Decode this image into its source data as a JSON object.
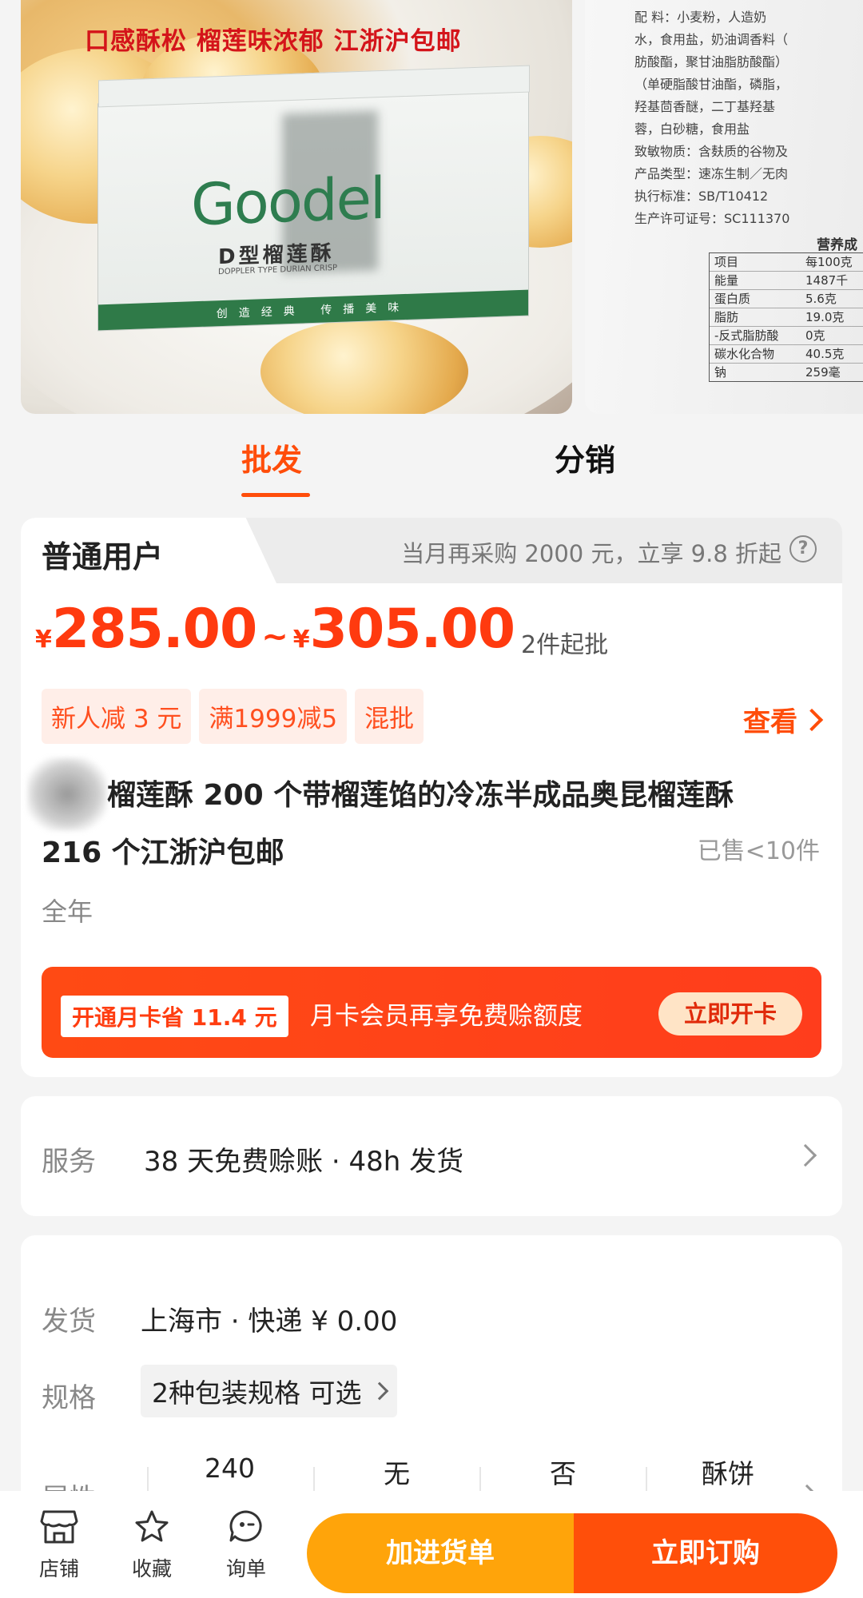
{
  "gallery": {
    "banner_text": "口感酥松 榴莲味浓郁 江浙沪包邮",
    "box_brand": "Goodel",
    "box_subtitle": "D型榴莲酥",
    "box_subtitle_en": "DOPPLER TYPE DURIAN CRISP",
    "box_slogan": "创造经典 传播美味",
    "label_lines": [
      "配    料：小麦粉，人造奶",
      "水，食用盐，奶油调香料（",
      "肪酸酯，聚甘油脂肪酸酯）",
      "（单硬脂酸甘油酯，磷脂，",
      "羟基茴香醚，二丁基羟基",
      "蓉，白砂糖，食用盐",
      "致敏物质：含麸质的谷物及",
      "产品类型：速冻生制／无肉",
      "执行标准：SB/T10412",
      "生产许可证号：SC111370"
    ],
    "nutrition_title": "营养成",
    "nutrition_rows": [
      {
        "item": "项目",
        "value": "每100克"
      },
      {
        "item": "能量",
        "value": "1487千"
      },
      {
        "item": "蛋白质",
        "value": "5.6克"
      },
      {
        "item": "脂肪",
        "value": "19.0克"
      },
      {
        "item": "-反式脂肪酸",
        "value": "0克"
      },
      {
        "item": "碳水化合物",
        "value": "40.5克"
      },
      {
        "item": "钠",
        "value": "259毫"
      }
    ]
  },
  "mode_tabs": {
    "wholesale": "批发",
    "distribution": "分销"
  },
  "pricing": {
    "user_level": "普通用户",
    "promo": "当月再采购 2000 元，立享 9.8 折起",
    "currency": "¥",
    "price_low": "285.00",
    "range_sep": "~",
    "price_high": "305.00",
    "min_order": "2件起批",
    "tags": [
      "新人减 3 元",
      "满1999减5",
      "混批"
    ],
    "view_label": "查看"
  },
  "product": {
    "title_line1": "榴莲酥 200 个带榴莲馅的冷冻半成品奥昆榴莲酥",
    "title_line2": "216 个江浙沪包邮",
    "sold": "已售<10件",
    "season": "全年"
  },
  "month_card": {
    "offer": "开通月卡省 11.4 元",
    "text": "月卡会员再享免费赊额度",
    "button": "立即开卡"
  },
  "service": {
    "label": "服务",
    "value": "38 天免费赊账 · 48h 发货"
  },
  "shipping": {
    "label": "发货",
    "value": "上海市  ·  快递  ¥ 0.00"
  },
  "spec": {
    "label": "规格",
    "value": "2种包装规格 可选"
  },
  "attributes": {
    "label": "属性",
    "values": [
      "240",
      "无",
      "否",
      "酥饼"
    ]
  },
  "bottom_bar": {
    "store": "店铺",
    "favorite": "收藏",
    "inquiry": "询单",
    "add_cart": "加进货单",
    "order_now": "立即订购"
  },
  "colors": {
    "accent": "#ff4d0a",
    "price": "#ff3a0f",
    "cart_button": "#ffa40a",
    "order_button": "#ff4f0a"
  }
}
